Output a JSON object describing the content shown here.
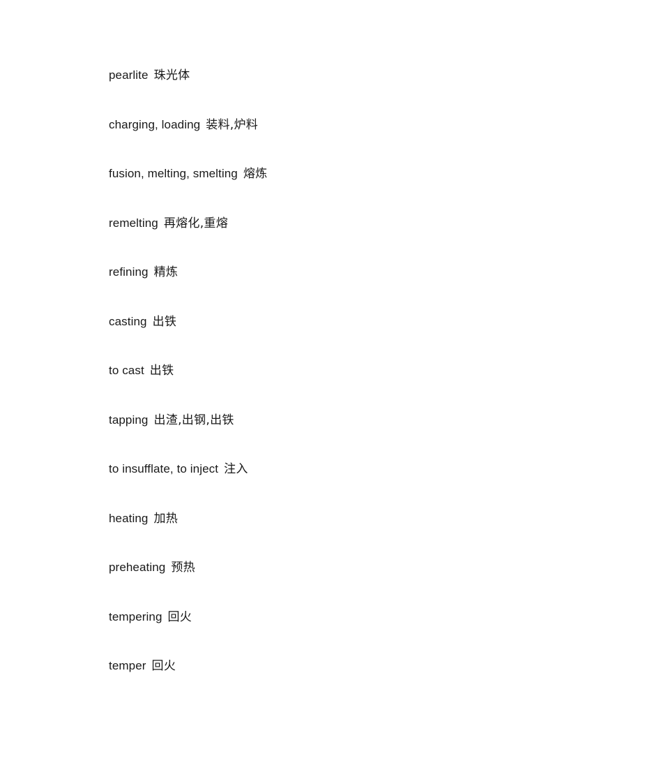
{
  "document": {
    "background_color": "#ffffff",
    "text_color": "#1a1a1a",
    "entries": [
      {
        "term": "pearlite",
        "gloss": "珠光体"
      },
      {
        "term": "charging, loading",
        "gloss": "装料,炉料"
      },
      {
        "term": "fusion, melting, smelting",
        "gloss": "熔炼"
      },
      {
        "term": "remelting",
        "gloss": "再熔化,重熔"
      },
      {
        "term": "refining",
        "gloss": "精炼"
      },
      {
        "term": "casting",
        "gloss": "出铁"
      },
      {
        "term": "to cast",
        "gloss": "出铁"
      },
      {
        "term": "tapping",
        "gloss": "出渣,出钢,出铁"
      },
      {
        "term": "to insufflate, to inject",
        "gloss": "注入"
      },
      {
        "term": "heating",
        "gloss": "加热"
      },
      {
        "term": "preheating",
        "gloss": "预热"
      },
      {
        "term": "tempering",
        "gloss": "回火"
      },
      {
        "term": "temper",
        "gloss": "回火"
      }
    ]
  }
}
